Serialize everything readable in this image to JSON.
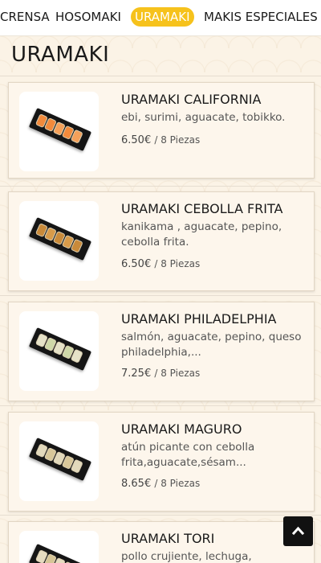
{
  "nav": {
    "tabs": [
      {
        "label": "CRENSA",
        "active": false
      },
      {
        "label": "HOSOMAKI",
        "active": false
      },
      {
        "label": "URAMAKI",
        "active": true
      },
      {
        "label": "MAKIS ESPECIALES",
        "active": false
      }
    ]
  },
  "section": {
    "title": "URAMAKI"
  },
  "products": [
    {
      "name": "URAMAKI CALIFORNIA",
      "description": "ebi, surimi, aguacate, tobikko.",
      "price": "6.50€",
      "unit": "/ 8 Piezas",
      "image_icon": "sushi-plate-california"
    },
    {
      "name": "URAMAKI CEBOLLA FRITA",
      "description": "kanikama ,  aguacate, pepino,\ncebolla frita.",
      "price": "6.50€",
      "unit": "/ 8 Piezas",
      "image_icon": "sushi-plate-cebolla-frita"
    },
    {
      "name": "URAMAKI PHILADELPHIA",
      "description": "salmón, aguacate, pepino, queso\nphiladelphia,...",
      "price": "7.25€",
      "unit": "/ 8 Piezas",
      "image_icon": "sushi-plate-philadelphia"
    },
    {
      "name": "URAMAKI MAGURO",
      "description": "atún picante con cebolla\nfrita,aguacate,sésam...",
      "price": "8.65€",
      "unit": "/ 8 Piezas",
      "image_icon": "sushi-plate-maguro"
    },
    {
      "name": "URAMAKI TORI",
      "description": "pollo crujiente, lechuga,",
      "price": "",
      "unit": "",
      "image_icon": "sushi-plate-tori"
    }
  ],
  "scroll_top": {
    "icon": "chevron-up-icon"
  },
  "colors": {
    "accent": "#f6c21c",
    "background": "#fbf3e6",
    "card": "#fdf6ec",
    "text": "#1a1a1a",
    "button": "#111111"
  }
}
